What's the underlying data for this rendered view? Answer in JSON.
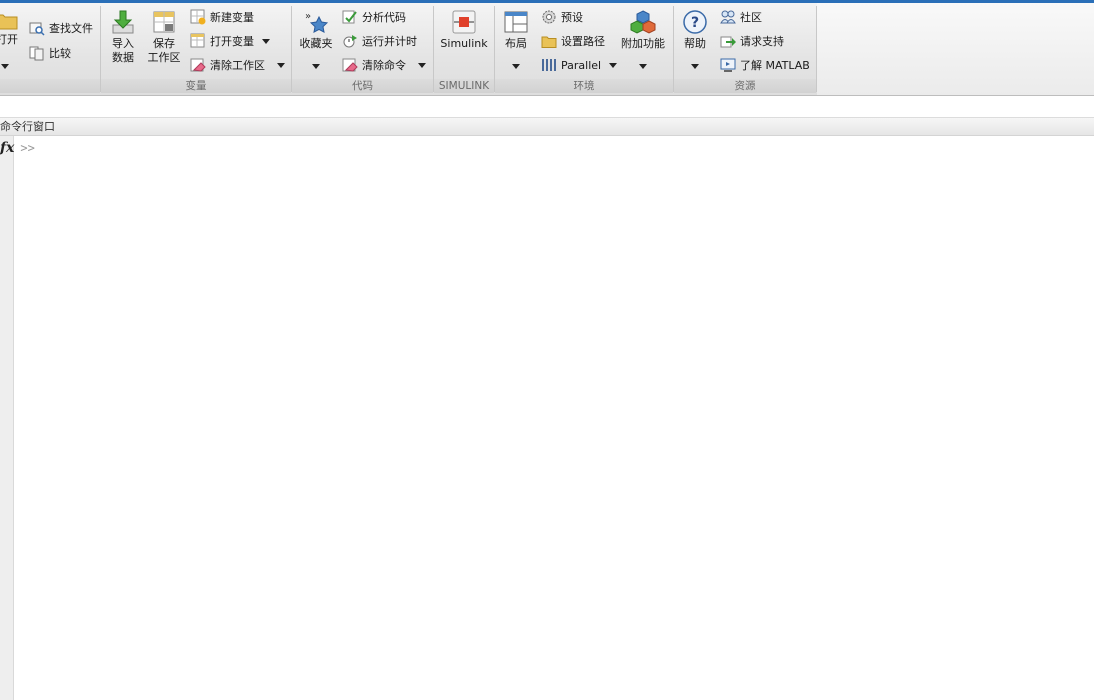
{
  "ribbon": {
    "file": {
      "open_label": "打开",
      "find_files_label": "查找文件",
      "compare_label": "比较"
    },
    "variable": {
      "group_label": "变量",
      "import_data_line1": "导入",
      "import_data_line2": "数据",
      "save_workspace_line1": "保存",
      "save_workspace_line2": "工作区",
      "new_variable_label": "新建变量",
      "open_variable_label": "打开变量",
      "clear_workspace_label": "清除工作区"
    },
    "code": {
      "group_label": "代码",
      "favorites_label": "收藏夹",
      "analyze_code_label": "分析代码",
      "run_and_time_label": "运行并计时",
      "clear_commands_label": "清除命令"
    },
    "simulink": {
      "group_label": "SIMULINK",
      "simulink_label": "Simulink"
    },
    "environment": {
      "group_label": "环境",
      "layout_label": "布局",
      "preferences_label": "预设",
      "set_path_label": "设置路径",
      "parallel_label": "Parallel",
      "addons_label": "附加功能"
    },
    "resources": {
      "group_label": "资源",
      "help_label": "帮助",
      "community_label": "社区",
      "request_support_label": "请求支持",
      "learn_matlab_label": "了解 MATLAB"
    }
  },
  "command_window": {
    "title": "命令行窗口",
    "fx_label": "fx",
    "prompt": ">>"
  },
  "colors": {
    "title_bar": "#2a6fb8",
    "ribbon_bg": "#e6e6e6",
    "group_label_bg": "#d4d4d4"
  }
}
